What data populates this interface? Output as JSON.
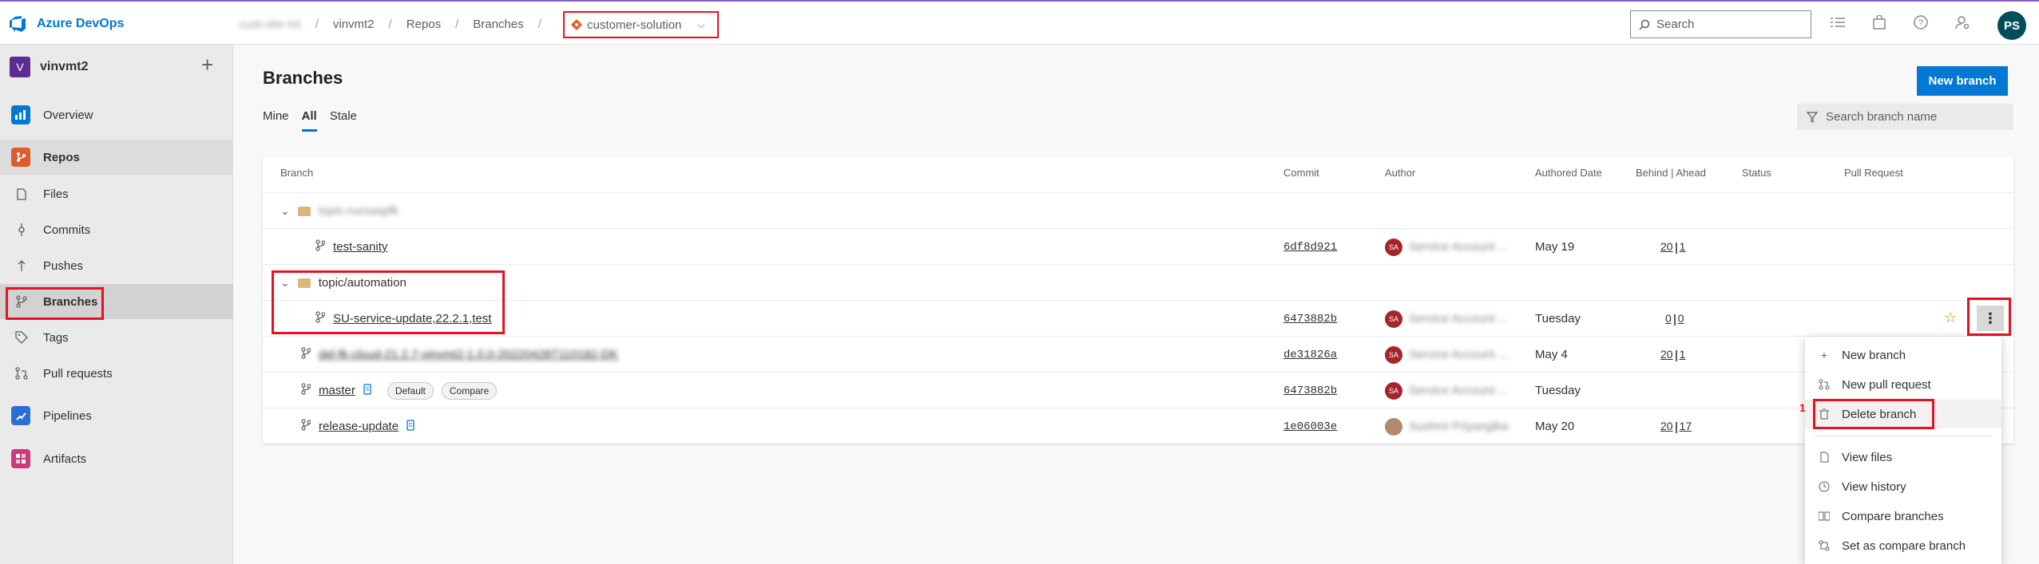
{
  "app": {
    "brand": "Azure DevOps"
  },
  "breadcrumb": {
    "org": "cust-ske-tst",
    "project": "vinvmt2",
    "section": "Repos",
    "page": "Branches",
    "repo": "customer-solution"
  },
  "search": {
    "placeholder": "Search"
  },
  "user": {
    "initials": "PS"
  },
  "sidebar": {
    "project_initial": "V",
    "project_name": "vinvmt2",
    "items": [
      {
        "label": "Overview",
        "icon": "overview-icon",
        "color": "#0078d4"
      },
      {
        "label": "Repos",
        "icon": "repos-icon",
        "color": "#e05b2b"
      },
      {
        "label": "Files",
        "icon": "file-icon"
      },
      {
        "label": "Commits",
        "icon": "commit-icon"
      },
      {
        "label": "Pushes",
        "icon": "push-icon"
      },
      {
        "label": "Branches",
        "icon": "branch-icon"
      },
      {
        "label": "Tags",
        "icon": "tag-icon"
      },
      {
        "label": "Pull requests",
        "icon": "pull-request-icon"
      },
      {
        "label": "Pipelines",
        "icon": "pipelines-icon",
        "color": "#2a6fd6"
      },
      {
        "label": "Artifacts",
        "icon": "artifacts-icon",
        "color": "#c93c7c"
      }
    ]
  },
  "main": {
    "title": "Branches",
    "tabs": [
      "Mine",
      "All",
      "Stale"
    ],
    "active_tab": "All",
    "new_branch_label": "New branch",
    "filter_placeholder": "Search branch name"
  },
  "table": {
    "columns": [
      "Branch",
      "Commit",
      "Author",
      "Authored Date",
      "Behind | Ahead",
      "Status",
      "Pull Request"
    ],
    "rows": [
      {
        "type": "folder",
        "name": "topic-ruciuwpfk",
        "blurred": true
      },
      {
        "type": "branch",
        "name": "test-sanity",
        "indent": 2,
        "commit": "6df8d921",
        "author": "Service Account ...",
        "author_initials": "SA",
        "date": "May 19",
        "behind": "20",
        "ahead": "1"
      },
      {
        "type": "folder",
        "name": "topic/automation",
        "blurred": false
      },
      {
        "type": "branch",
        "name": "SU-service-update,22.2.1,test",
        "indent": 2,
        "commit": "6473882b",
        "author": "Service Account ...",
        "author_initials": "SA",
        "date": "Tuesday",
        "behind": "0",
        "ahead": "0"
      },
      {
        "type": "branch",
        "name": "del-fk-cloud-21.2.7-vinvmt2-1.0.0-20220428T110182-DK",
        "blurred": true,
        "indent": 1,
        "commit": "de31826a",
        "author": "Service Account ...",
        "author_initials": "SA",
        "date": "May 4",
        "behind": "20",
        "ahead": "1"
      },
      {
        "type": "branch",
        "name": "master",
        "indent": 1,
        "commit": "6473882b",
        "author": "Service Account ...",
        "author_initials": "SA",
        "date": "Tuesday",
        "tags": [
          "Default",
          "Compare"
        ]
      },
      {
        "type": "branch",
        "name": "release-update",
        "indent": 1,
        "commit": "1e06003e",
        "author": "Sushmi Priyangika",
        "author_initials": "",
        "date": "May 20",
        "behind": "20",
        "ahead": "17"
      }
    ]
  },
  "context_menu": {
    "step_number": "1",
    "items": [
      {
        "label": "New branch",
        "icon": "plus-icon"
      },
      {
        "label": "New pull request",
        "icon": "pull-request-icon"
      },
      {
        "label": "Delete branch",
        "icon": "trash-icon"
      },
      {
        "label": "View files",
        "icon": "file-icon"
      },
      {
        "label": "View history",
        "icon": "history-icon"
      },
      {
        "label": "Compare branches",
        "icon": "compare-icon"
      },
      {
        "label": "Set as compare branch",
        "icon": "set-compare-icon"
      }
    ]
  }
}
